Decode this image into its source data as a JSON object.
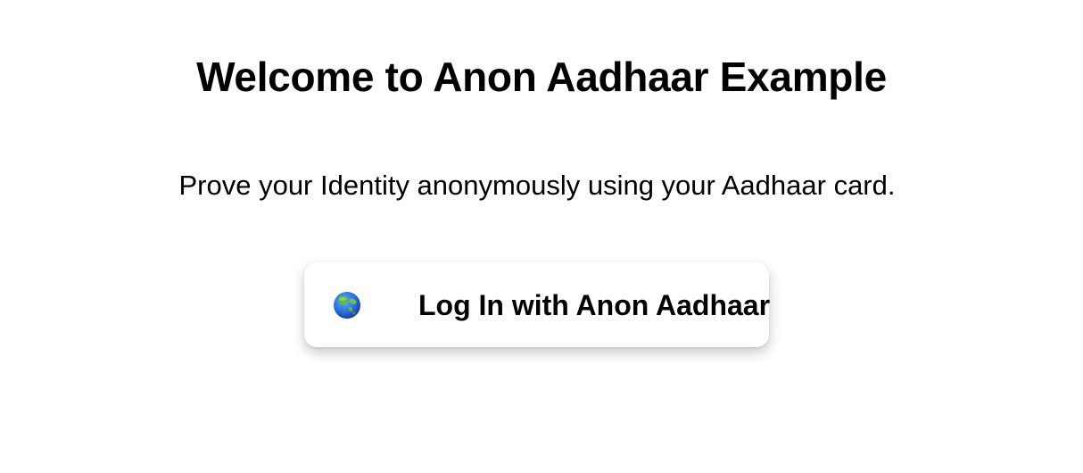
{
  "page": {
    "title": "Welcome to Anon Aadhaar Example",
    "subtitle": "Prove your Identity anonymously using your Aadhaar card."
  },
  "login_button": {
    "icon": "globe-asia-icon",
    "label": "Log In with Anon Aadhaar"
  },
  "colors": {
    "background": "#ffffff",
    "text": "#000000",
    "globe_ocean": "#2a6fd6",
    "globe_land": "#4caf50"
  }
}
